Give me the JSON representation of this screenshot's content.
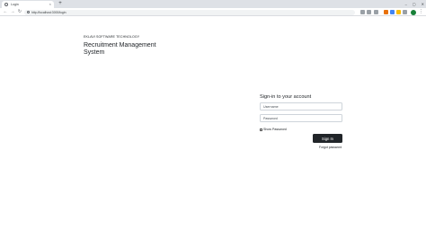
{
  "browser": {
    "tab_title": "Login",
    "url": "http://localhost:3000/login",
    "new_tab_symbol": "+",
    "close_symbol": "×",
    "window_controls": [
      "–",
      "▢",
      "✕"
    ],
    "nav": {
      "back": "←",
      "forward": "→",
      "reload": "↻"
    },
    "extension_colors": [
      "#fbbc04",
      "#e8710a",
      "#4285f4",
      "#9aa0a6"
    ],
    "profile_color": "#188038"
  },
  "page": {
    "company": "EKLAVI SOFTWARE TECHNOLOGY",
    "app_title": "Recruitment Management System",
    "signin": {
      "heading": "Sign-in to your account",
      "username_placeholder": "Username",
      "password_placeholder": "Password",
      "show_password_label": "Show Password",
      "button_label": "Sign In",
      "forgot_label": "Forgot password"
    }
  }
}
